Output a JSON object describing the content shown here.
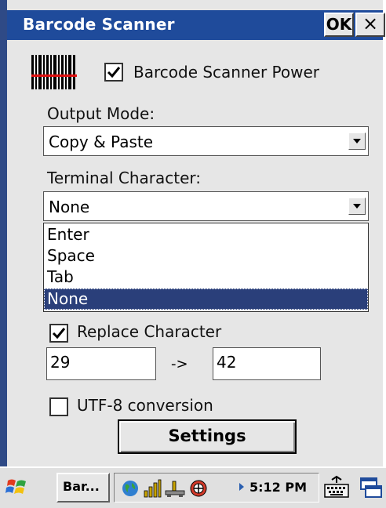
{
  "window": {
    "title": "Barcode Scanner",
    "ok_label": "OK",
    "close_label": "×"
  },
  "power": {
    "checked": true,
    "label": "Barcode Scanner Power"
  },
  "output_mode": {
    "label": "Output Mode:",
    "value": "Copy & Paste"
  },
  "terminal_character": {
    "label": "Terminal Character:",
    "value": "None",
    "options": [
      "Enter",
      "Space",
      "Tab",
      "None"
    ],
    "selected_index": 3
  },
  "replace_character": {
    "checked": true,
    "label": "Replace Character",
    "from_value": "29",
    "arrow": "->",
    "to_value": "42"
  },
  "utf8": {
    "checked": false,
    "label": "UTF-8 conversion"
  },
  "settings_button": {
    "label": "Settings"
  },
  "taskbar": {
    "task_label": "Bar...",
    "time": "5:12 PM",
    "icons": [
      "start-flag-icon",
      "globe-icon",
      "signal-bars-icon",
      "network-icon",
      "volume-icon",
      "keyboard-icon",
      "window-switch-icon"
    ]
  },
  "colors": {
    "titlebar": "#1f4b9b",
    "selection": "#2a3f7a",
    "dialog_bg": "#e6e6e6"
  }
}
